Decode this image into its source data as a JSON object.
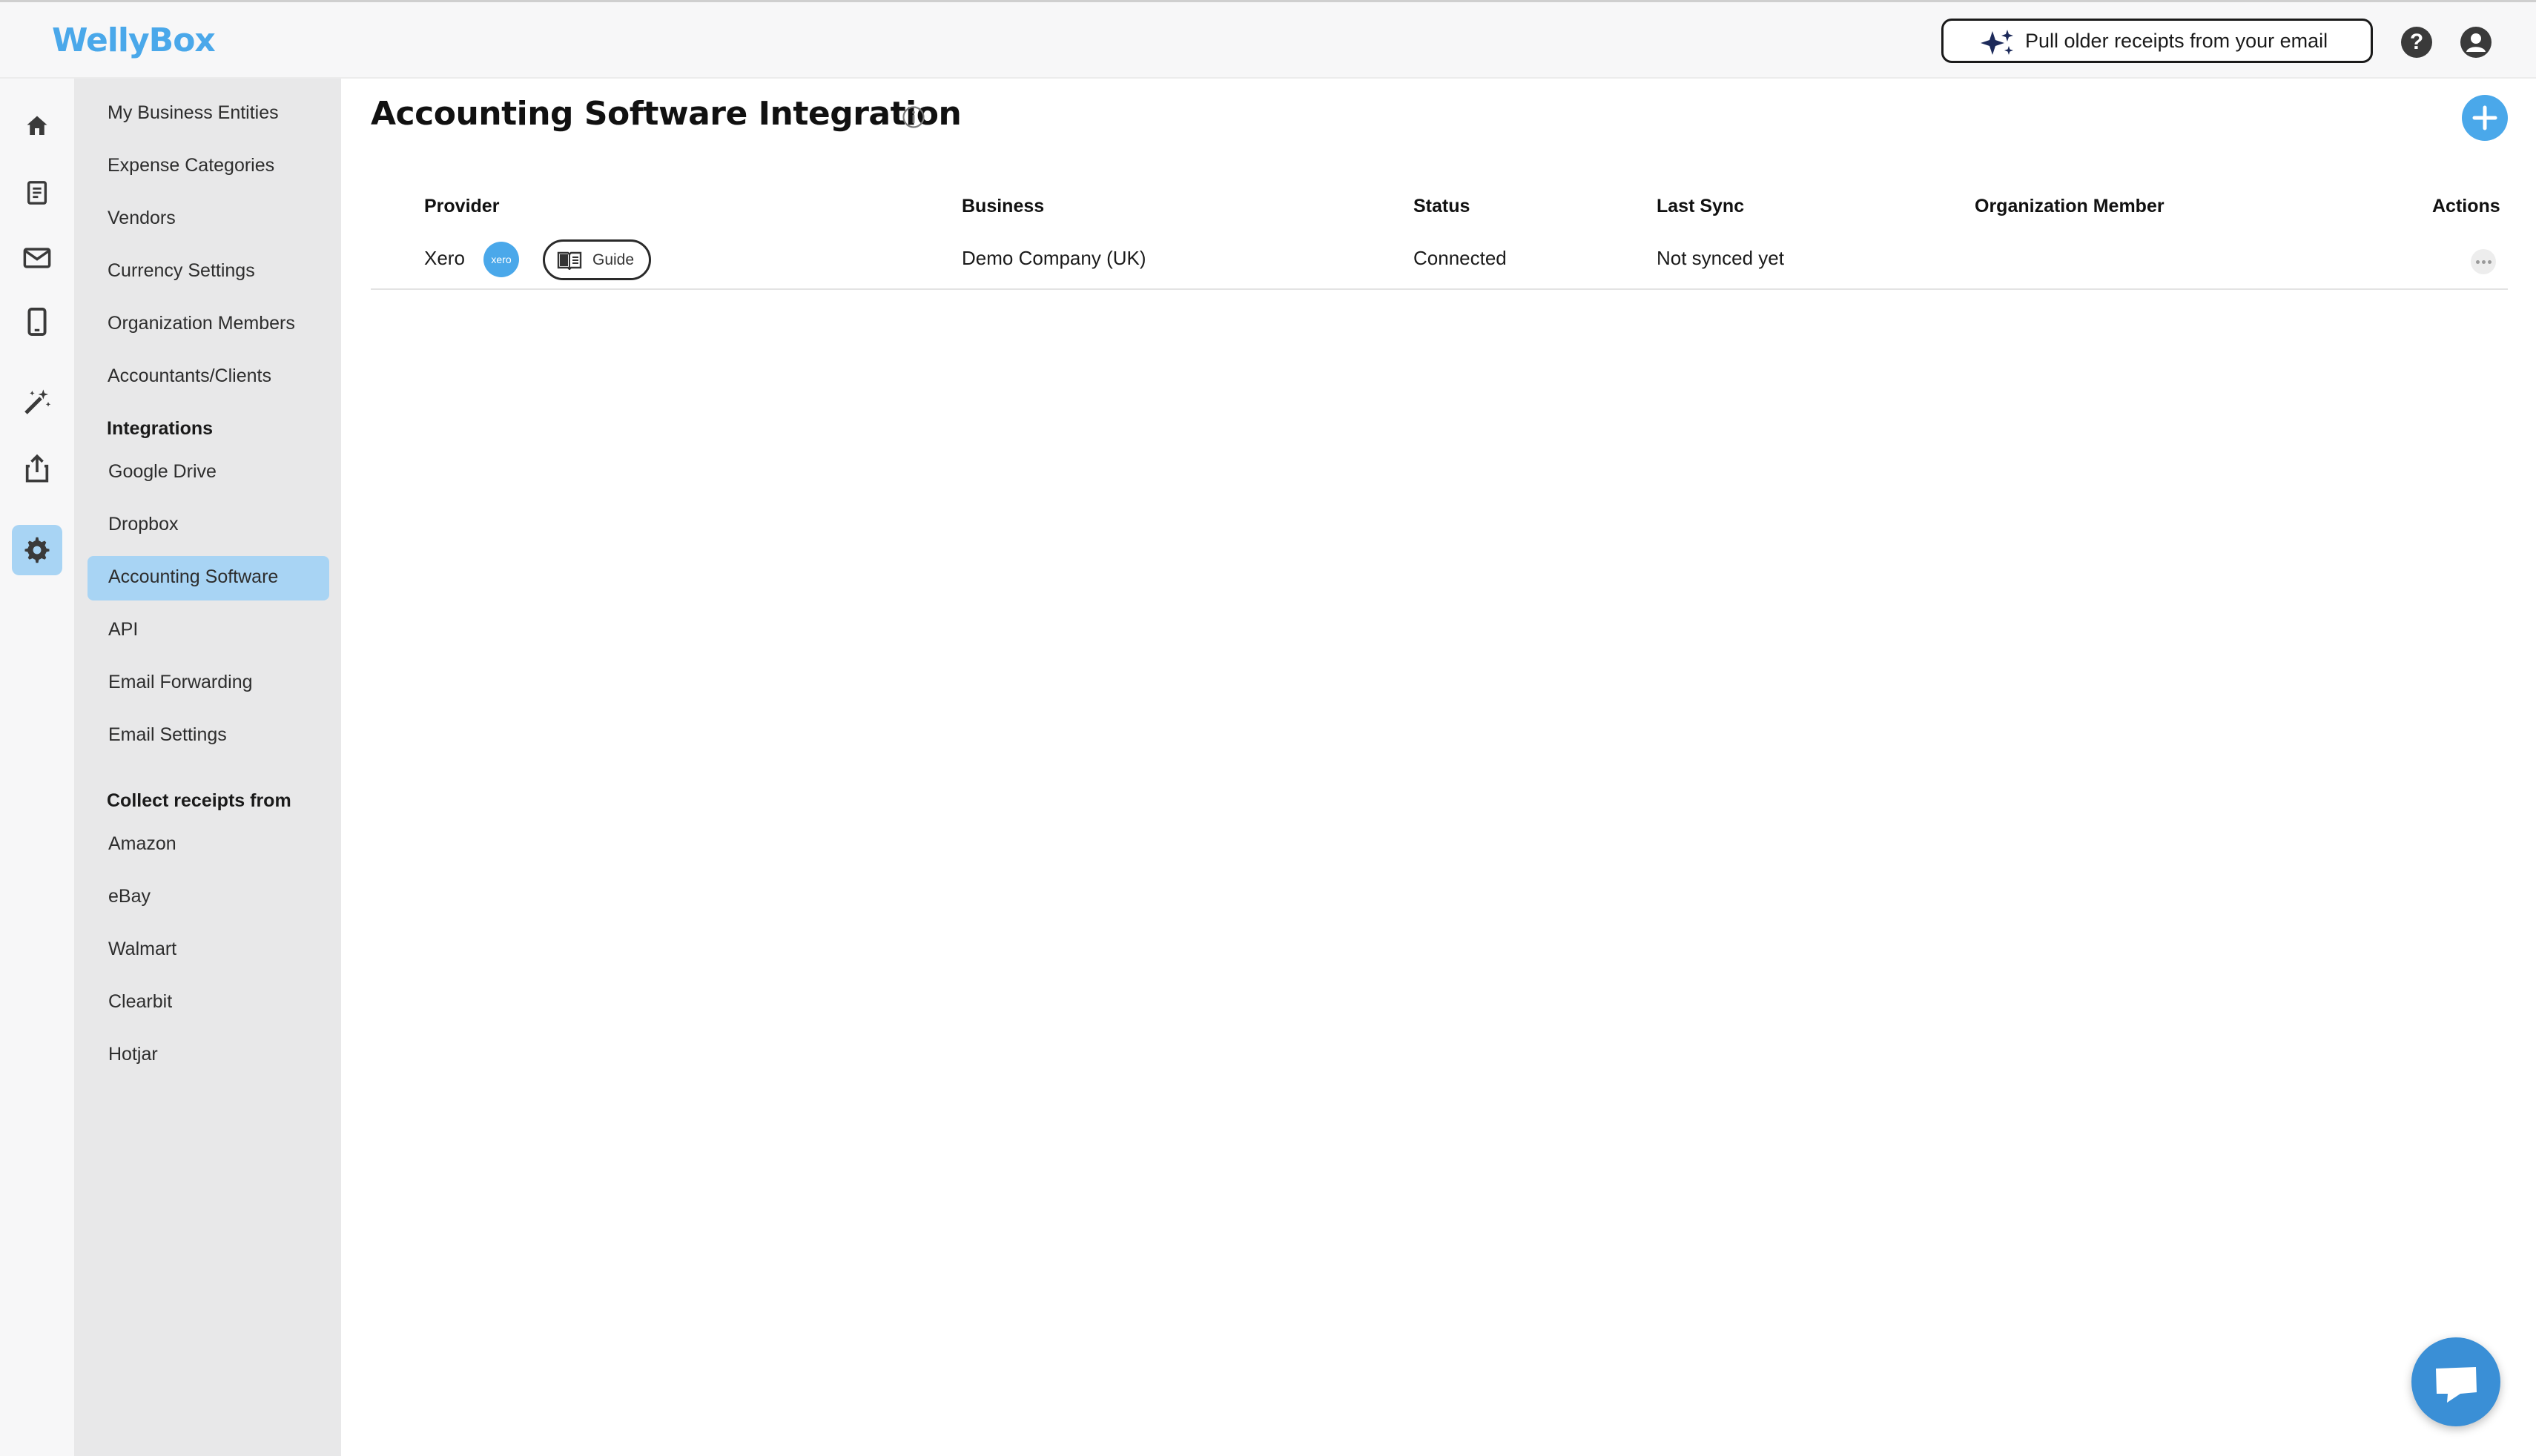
{
  "app": {
    "logo": "WellyBox"
  },
  "header": {
    "pull_button_label": "Pull older receipts from your email",
    "help_label": "?"
  },
  "rail": {
    "items": [
      {
        "icon": "home-icon"
      },
      {
        "icon": "receipt-icon"
      },
      {
        "icon": "mail-icon"
      },
      {
        "icon": "mobile-icon"
      },
      {
        "icon": "magic-wand-icon"
      },
      {
        "icon": "export-icon"
      },
      {
        "icon": "gear-icon",
        "active": true
      }
    ]
  },
  "sidebar": {
    "items": [
      "My Business Entities",
      "Expense Categories",
      "Vendors",
      "Currency Settings",
      "Organization Members",
      "Accountants/Clients"
    ],
    "integrations_heading": "Integrations",
    "integrations": [
      "Google Drive",
      "Dropbox",
      "Accounting Software",
      "API",
      "Email Forwarding",
      "Email Settings"
    ],
    "active_item": "Accounting Software",
    "collect_heading": "Collect receipts from",
    "collect": [
      "Amazon",
      "eBay",
      "Walmart",
      "Clearbit",
      "Hotjar"
    ]
  },
  "main": {
    "title": "Accounting Software Integration",
    "table": {
      "headers": [
        "Provider",
        "Business",
        "Status",
        "Last Sync",
        "Organization Member",
        "Actions"
      ],
      "rows": [
        {
          "provider": "Xero",
          "provider_badge": "xero",
          "guide_label": "Guide",
          "business": "Demo Company (UK)",
          "status": "Connected",
          "last_sync": "Not synced yet",
          "organization_member": ""
        }
      ]
    }
  },
  "colors": {
    "accent": "#4aa8ea",
    "active_bg": "#a8d4f4",
    "sidebar_bg": "#e8e8e9",
    "chat": "#3a8fd6"
  }
}
